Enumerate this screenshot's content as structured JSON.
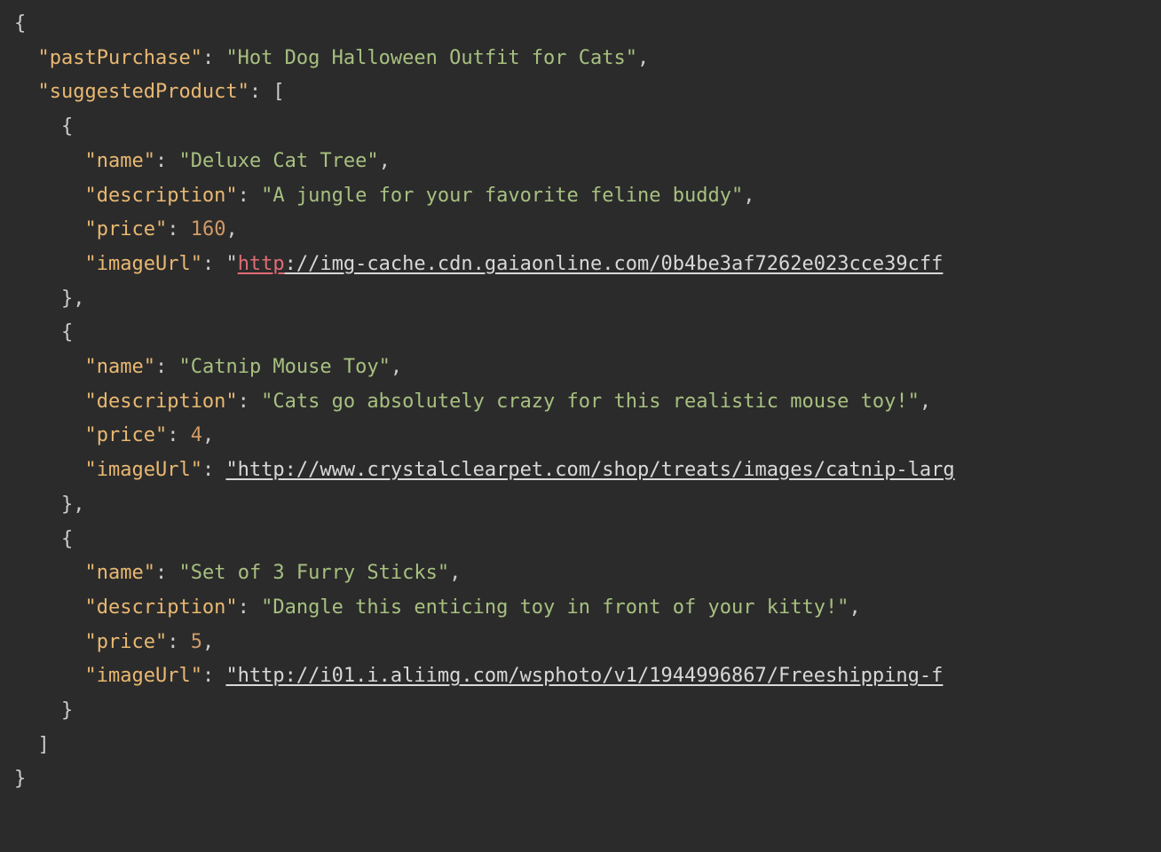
{
  "code": {
    "keys": {
      "pastPurchase": "\"pastPurchase\"",
      "suggestedProduct": "\"suggestedProduct\"",
      "name": "\"name\"",
      "description": "\"description\"",
      "price": "\"price\"",
      "imageUrl": "\"imageUrl\""
    },
    "values": {
      "pastPurchase": "\"Hot Dog Halloween Outfit for Cats\"",
      "p1_name": "\"Deluxe Cat Tree\"",
      "p1_desc": "\"A jungle for your favorite feline buddy\"",
      "p1_price": "160",
      "p1_url_prefix": "\"",
      "p1_url_http": "http",
      "p1_url_rest": "://img-cache.cdn.gaiaonline.com/0b4be3af7262e023cce39cff",
      "p2_name": "\"Catnip Mouse Toy\"",
      "p2_desc": "\"Cats go absolutely crazy for this realistic mouse toy!\"",
      "p2_price": "4",
      "p2_url": "\"http://www.crystalclearpet.com/shop/treats/images/catnip-larg",
      "p3_name": "\"Set of 3 Furry Sticks\"",
      "p3_desc": "\"Dangle this enticing toy in front of your kitty!\"",
      "p3_price": "5",
      "p3_url": "\"http://i01.i.aliimg.com/wsphoto/v1/1944996867/Freeshipping-f"
    },
    "punct": {
      "colon_sp": ": ",
      "comma": ",",
      "open_arr": "[",
      "close_arr": "]",
      "open_obj": "{",
      "close_obj": "}",
      "close_obj_comma": "},"
    }
  }
}
